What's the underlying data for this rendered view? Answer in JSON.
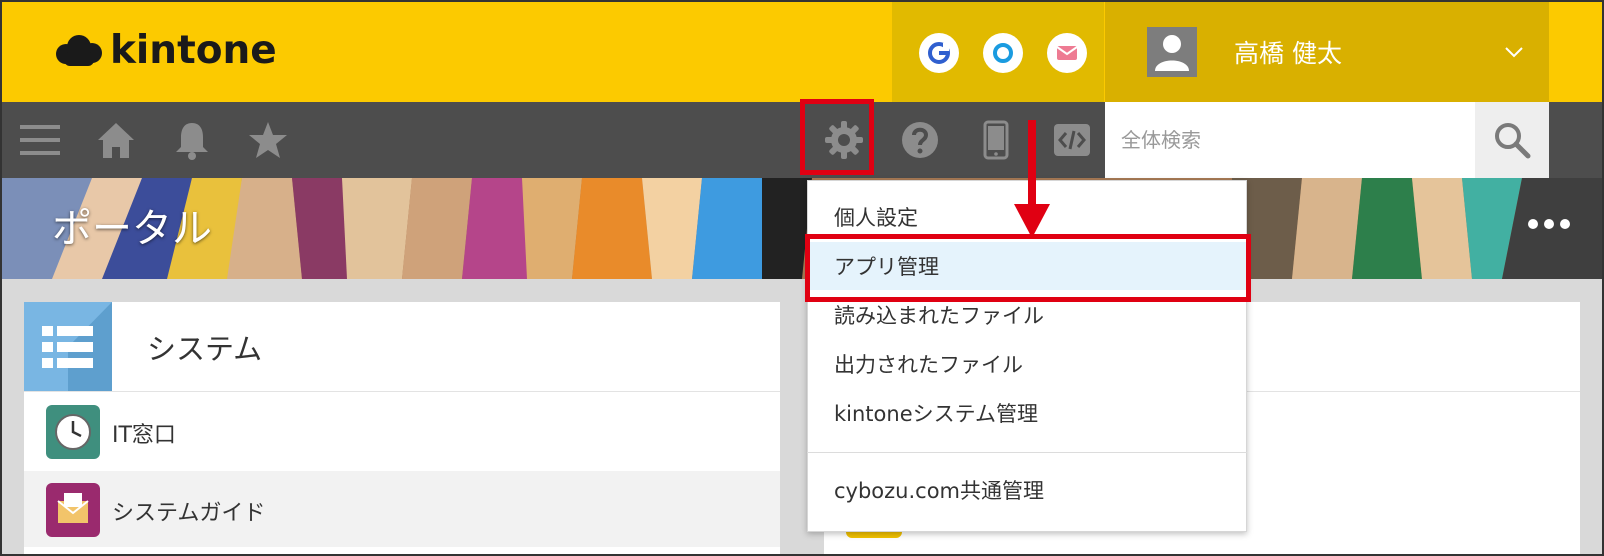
{
  "header": {
    "logo_text": "kintone",
    "user_name": "高橋 健太"
  },
  "toolbar": {
    "search_placeholder": "全体検索"
  },
  "banner": {
    "title": "ポータル"
  },
  "settings_menu": {
    "items": [
      "個人設定",
      "アプリ管理",
      "読み込まれたファイル",
      "出力されたファイル",
      "kintoneシステム管理",
      "cybozu.com共通管理"
    ]
  },
  "space_card": {
    "title": "システム",
    "apps": [
      "IT窓口",
      "システムガイド"
    ]
  },
  "colors": {
    "header_yellow": "#fcca00",
    "toolbar_gray": "#4d4d4d",
    "annotation_red": "#e00012",
    "menu_selected_bg": "#e5f3fc"
  },
  "icons": [
    "google-icon",
    "cybozu-office-icon",
    "mail-icon",
    "user-avatar-icon",
    "chevron-down-icon",
    "menu-icon",
    "home-icon",
    "bell-icon",
    "star-icon",
    "gear-icon",
    "help-icon",
    "mobile-icon",
    "code-icon",
    "search-icon",
    "more-icon",
    "list-icon",
    "clock-icon",
    "envelope-icon"
  ]
}
